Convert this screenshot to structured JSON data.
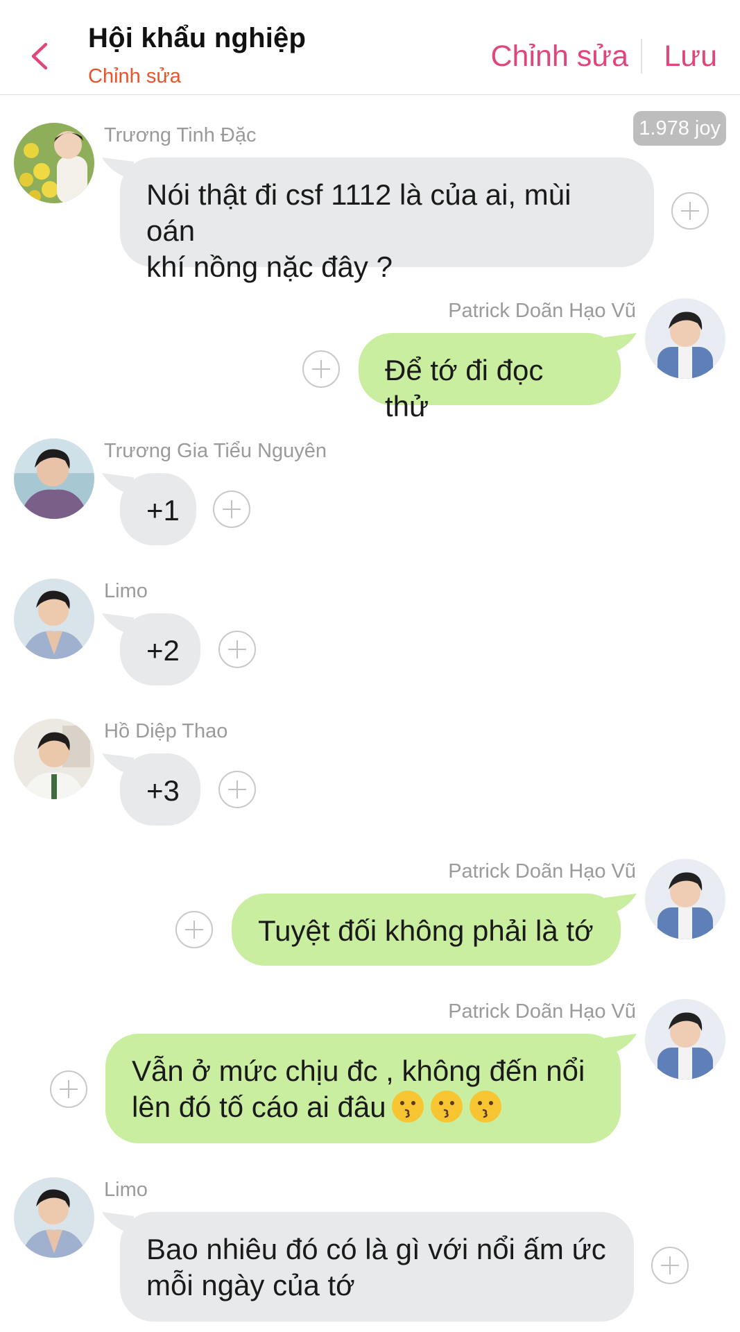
{
  "header": {
    "title": "Hội khẩu nghiệp",
    "subtitle": "Chỉnh sửa",
    "edit_label": "Chỉnh sửa",
    "save_label": "Lưu"
  },
  "joy_badge": "1.978 joy",
  "messages": [
    {
      "side": "left",
      "sender": "Trương Tinh Đặc",
      "text_lines": [
        "Nói thật đi csf 1112 là của ai, mùi oán",
        "khí nồng nặc đây ?"
      ]
    },
    {
      "side": "right",
      "sender": "Patrick Doãn Hạo Vũ",
      "text": "Để tớ đi đọc thử"
    },
    {
      "side": "left",
      "sender": "Trương Gia Tiểu Nguyên",
      "text": "+1"
    },
    {
      "side": "left",
      "sender": "Limo",
      "text": "+2"
    },
    {
      "side": "left",
      "sender": "Hồ Diệp Thao",
      "text": "+3"
    },
    {
      "side": "right",
      "sender": "Patrick Doãn Hạo Vũ",
      "text": "Tuyệt đối không phải là tớ"
    },
    {
      "side": "right",
      "sender": "Patrick Doãn Hạo Vũ",
      "text_lines": [
        "Vẫn ở mức chịu đc , không đến nổi",
        "lên đó tố cáo ai đâu"
      ],
      "emoji": "kissing-face"
    },
    {
      "side": "left",
      "sender": "Limo",
      "text_lines": [
        "Bao nhiêu đó có là gì với nổi ấm ức",
        "mỗi ngày của tớ"
      ]
    }
  ],
  "colors": {
    "accent": "#e0467a",
    "subtitle": "#e8542a",
    "bubble_incoming": "#e8e9ea",
    "bubble_outgoing": "#c9eea0",
    "sender_name": "#9a9a9a"
  }
}
